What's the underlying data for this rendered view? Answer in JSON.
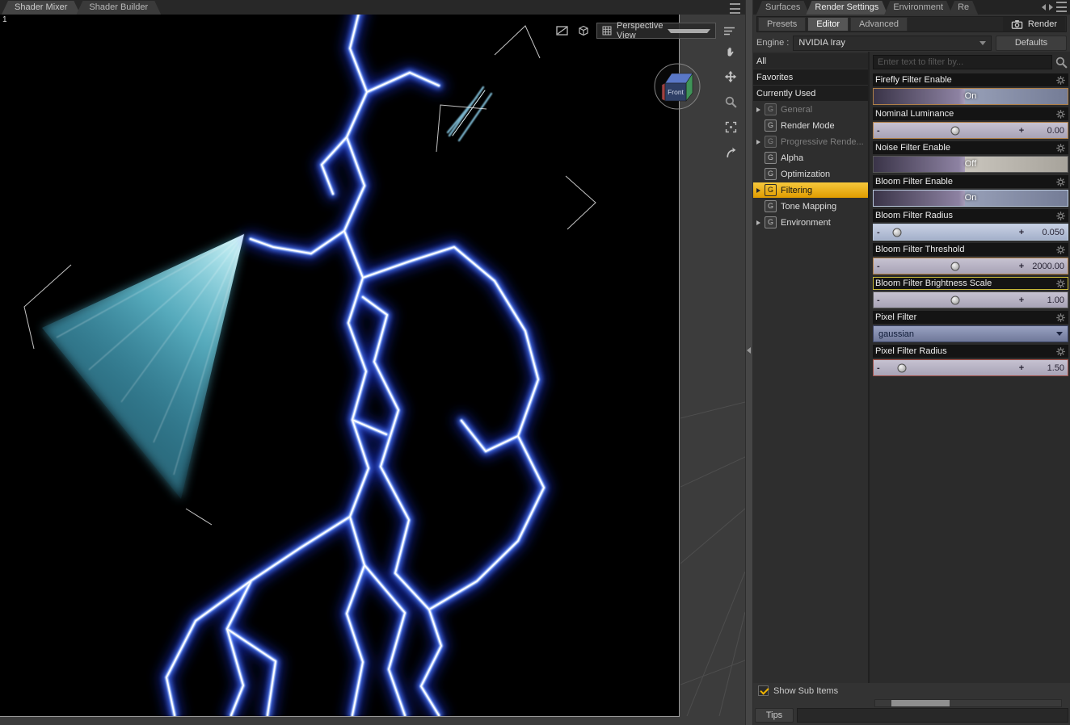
{
  "ui": {
    "minus": "-",
    "plus": "+",
    "g_badge": "G"
  },
  "viewport": {
    "tabs": [
      {
        "label": "Shader Mixer"
      },
      {
        "label": "Shader Builder"
      }
    ],
    "frame_label": "1",
    "view_selector": "Perspective View",
    "cube_front_label": "Front"
  },
  "panel": {
    "tabs": [
      {
        "label": "Surfaces"
      },
      {
        "label": "Render Settings"
      },
      {
        "label": "Environment"
      },
      {
        "label": "Re"
      }
    ],
    "toolbar": {
      "presets": "Presets",
      "editor": "Editor",
      "advanced": "Advanced",
      "render": "Render"
    },
    "engine": {
      "label": "Engine :",
      "value": "NVIDIA Iray",
      "defaults": "Defaults"
    },
    "filter_placeholder": "Enter text to filter by...",
    "categories": [
      {
        "label": "All"
      },
      {
        "label": "Favorites"
      },
      {
        "label": "Currently Used"
      },
      {
        "label": "General"
      },
      {
        "label": "Render Mode"
      },
      {
        "label": "Progressive Rende..."
      },
      {
        "label": "Alpha"
      },
      {
        "label": "Optimization"
      },
      {
        "label": "Filtering"
      },
      {
        "label": "Tone Mapping"
      },
      {
        "label": "Environment"
      }
    ],
    "parameters": [
      {
        "label": "Firefly Filter Enable",
        "value": "On"
      },
      {
        "label": "Nominal Luminance",
        "value": "0.00"
      },
      {
        "label": "Noise Filter Enable",
        "value": "Off"
      },
      {
        "label": "Bloom Filter Enable",
        "value": "On"
      },
      {
        "label": "Bloom Filter Radius",
        "value": "0.050"
      },
      {
        "label": "Bloom Filter Threshold",
        "value": "2000.00"
      },
      {
        "label": "Bloom Filter Brightness Scale",
        "value": "1.00"
      },
      {
        "label": "Pixel Filter",
        "value": "gaussian"
      },
      {
        "label": "Pixel Filter Radius",
        "value": "1.50"
      }
    ],
    "footer": {
      "show_sub_items": "Show Sub Items",
      "tips": "Tips"
    }
  }
}
